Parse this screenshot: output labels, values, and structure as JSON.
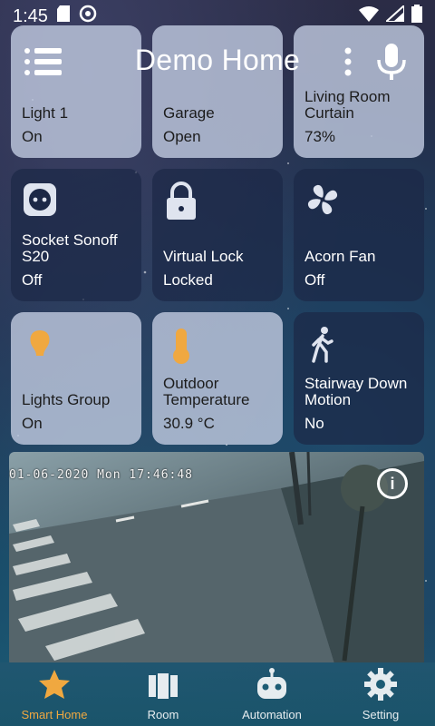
{
  "status_bar": {
    "time": "1:45"
  },
  "app_bar": {
    "title": "Demo Home"
  },
  "tiles": [
    {
      "name": "Light 1",
      "state": "On",
      "active": true,
      "icon": "bulb-icon"
    },
    {
      "name": "Garage",
      "state": "Open",
      "active": true,
      "icon": "garage-icon"
    },
    {
      "name": "Living Room Curtain",
      "state": "73%",
      "active": true,
      "icon": "curtain-icon"
    },
    {
      "name": "Socket Sonoff S20",
      "state": "Off",
      "active": false,
      "icon": "socket-icon"
    },
    {
      "name": "Virtual Lock",
      "state": "Locked",
      "active": false,
      "icon": "lock-icon"
    },
    {
      "name": "Acorn Fan",
      "state": "Off",
      "active": false,
      "icon": "fan-icon"
    },
    {
      "name": "Lights Group",
      "state": "On",
      "active": true,
      "icon": "bulb-icon"
    },
    {
      "name": "Outdoor Temperature",
      "state": "30.9 °C",
      "active": true,
      "icon": "thermometer-icon"
    },
    {
      "name": "Stairway Down Motion",
      "state": "No",
      "active": false,
      "icon": "walking-person-icon"
    }
  ],
  "camera": {
    "timestamp": "01-06-2020 Mon 17:46:48",
    "info_label": "i"
  },
  "bottom_nav": [
    {
      "label": "Smart Home",
      "icon": "star-icon",
      "active": true
    },
    {
      "label": "Room",
      "icon": "room-icon",
      "active": false
    },
    {
      "label": "Automation",
      "icon": "robot-icon",
      "active": false
    },
    {
      "label": "Setting",
      "icon": "gear-icon",
      "active": false
    }
  ],
  "colors": {
    "accent": "#f0a840",
    "tile_on": "#bec8de",
    "tile_off": "#1c2846"
  }
}
